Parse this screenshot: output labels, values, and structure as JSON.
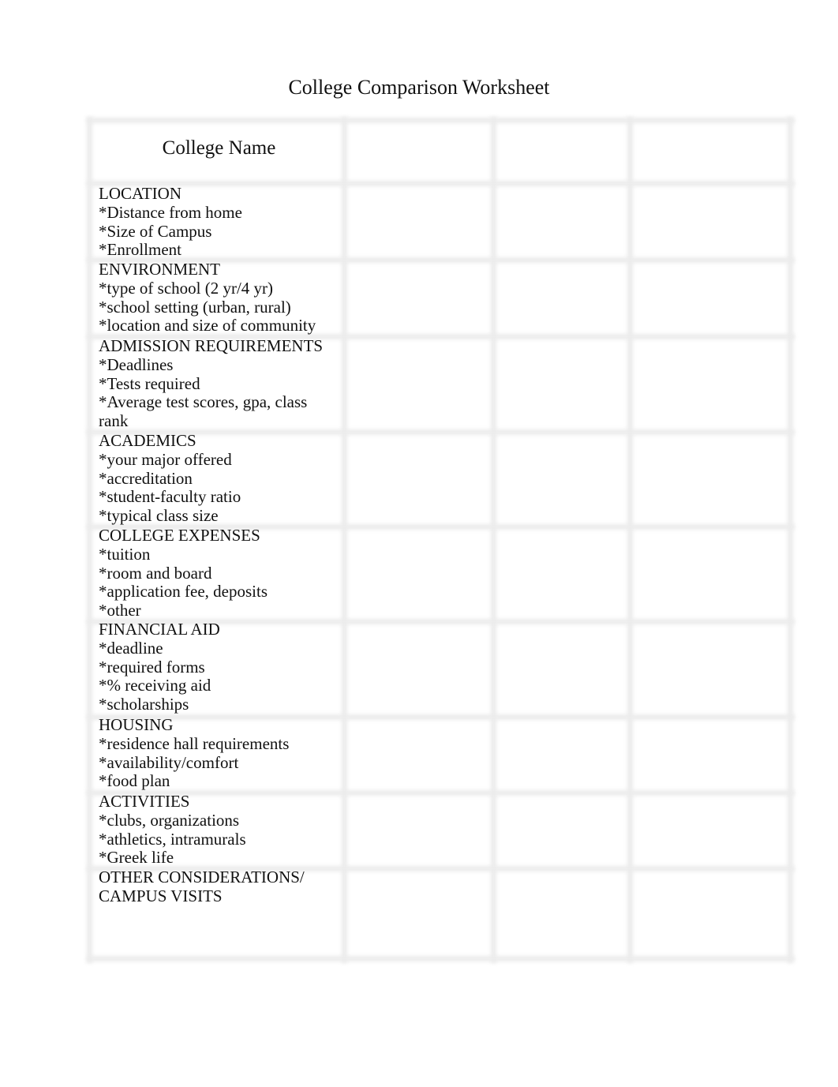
{
  "title": "College Comparison Worksheet",
  "table": {
    "header_label": "College Name",
    "college_columns": [
      "",
      "",
      ""
    ],
    "sections": [
      {
        "heading": "LOCATION",
        "items": [
          "*Distance from home",
          "*Size of Campus",
          "*Enrollment"
        ]
      },
      {
        "heading": "ENVIRONMENT",
        "items": [
          "*type of school (2 yr/4 yr)",
          "*school setting (urban, rural)",
          "*location and size of community"
        ]
      },
      {
        "heading": "ADMISSION REQUIREMENTS",
        "items": [
          "*Deadlines",
          "*Tests required",
          "*Average test scores, gpa, class rank"
        ]
      },
      {
        "heading": "ACADEMICS",
        "items": [
          "*your major offered",
          "*accreditation",
          "*student-faculty ratio",
          "*typical class size"
        ]
      },
      {
        "heading": "COLLEGE EXPENSES",
        "items": [
          "*tuition",
          "*room and board",
          "*application fee, deposits",
          "*other"
        ]
      },
      {
        "heading": "FINANCIAL AID",
        "items": [
          "*deadline",
          "*required forms",
          "*% receiving aid",
          "*scholarships"
        ]
      },
      {
        "heading": "HOUSING",
        "items": [
          "*residence hall requirements",
          "*availability/comfort",
          "*food plan"
        ]
      },
      {
        "heading": "ACTIVITIES",
        "items": [
          "*clubs, organizations",
          "*athletics, intramurals",
          "*Greek life"
        ]
      },
      {
        "heading": "OTHER CONSIDERATIONS/ CAMPUS VISITS",
        "items": []
      }
    ]
  }
}
